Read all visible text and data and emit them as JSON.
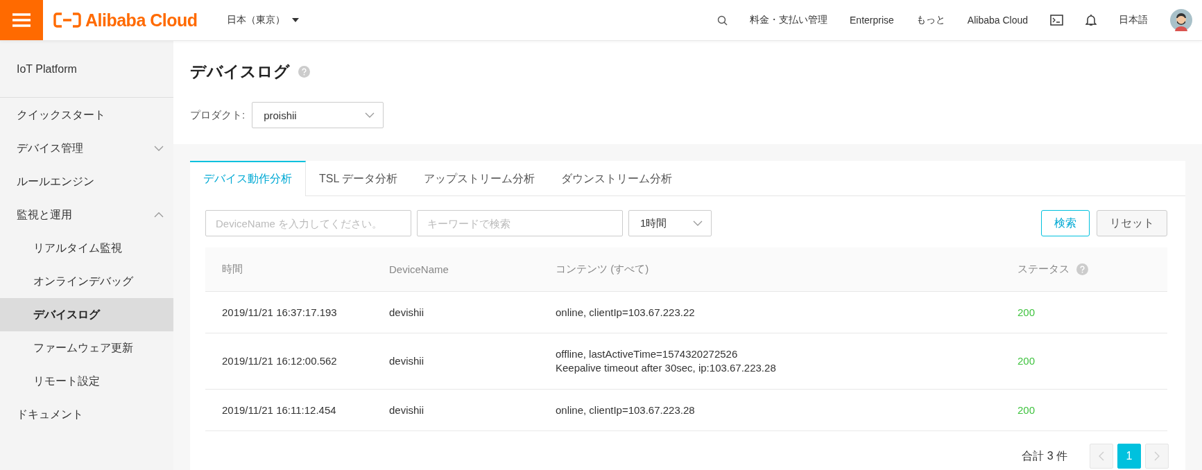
{
  "topbar": {
    "logo_text": "Alibaba Cloud",
    "region": "日本（東京）",
    "links": [
      "料金・支払い管理",
      "Enterprise",
      "もっと",
      "Alibaba Cloud"
    ],
    "language": "日本語"
  },
  "sidebar": {
    "title": "IoT Platform",
    "items": [
      {
        "label": "クイックスタート",
        "selected": false
      },
      {
        "label": "デバイス管理",
        "selected": false,
        "expanded": false
      },
      {
        "label": "ルールエンジン",
        "selected": false
      },
      {
        "label": "監視と運用",
        "selected": false,
        "expanded": true,
        "children": [
          {
            "label": "リアルタイム監視",
            "selected": false
          },
          {
            "label": "オンラインデバッグ",
            "selected": false
          },
          {
            "label": "デバイスログ",
            "selected": true
          },
          {
            "label": "ファームウェア更新",
            "selected": false
          },
          {
            "label": "リモート設定",
            "selected": false
          }
        ]
      },
      {
        "label": "ドキュメント",
        "selected": false
      }
    ]
  },
  "page": {
    "title": "デバイスログ",
    "product_label": "プロダクト:",
    "product": "proishii"
  },
  "tabs": [
    {
      "label": "デバイス動作分析",
      "selected": true
    },
    {
      "label": "TSL データ分析",
      "selected": false
    },
    {
      "label": "アップストリーム分析",
      "selected": false
    },
    {
      "label": "ダウンストリーム分析",
      "selected": false
    }
  ],
  "filters": {
    "device_placeholder": "DeviceName を入力してください。",
    "keyword_placeholder": "キーワードで検索",
    "period": "1時間",
    "search_button": "検索",
    "reset_button": "リセット"
  },
  "table": {
    "columns": [
      "時間",
      "DeviceName",
      "コンテンツ (すべて)",
      "ステータス"
    ],
    "rows": [
      {
        "time": "2019/11/21 16:37:17.193",
        "device": "devishii",
        "content": [
          "online, clientIp=103.67.223.22"
        ],
        "status": "200"
      },
      {
        "time": "2019/11/21 16:12:00.562",
        "device": "devishii",
        "content": [
          "offline, lastActiveTime=1574320272526",
          "Keepalive timeout after 30sec, ip:103.67.223.28"
        ],
        "status": "200"
      },
      {
        "time": "2019/11/21 16:11:12.454",
        "device": "devishii",
        "content": [
          "online, clientIp=103.67.223.28"
        ],
        "status": "200"
      }
    ]
  },
  "pagination": {
    "total": "合計 3 件",
    "pages": [
      {
        "label": "1",
        "selected": true
      }
    ]
  }
}
